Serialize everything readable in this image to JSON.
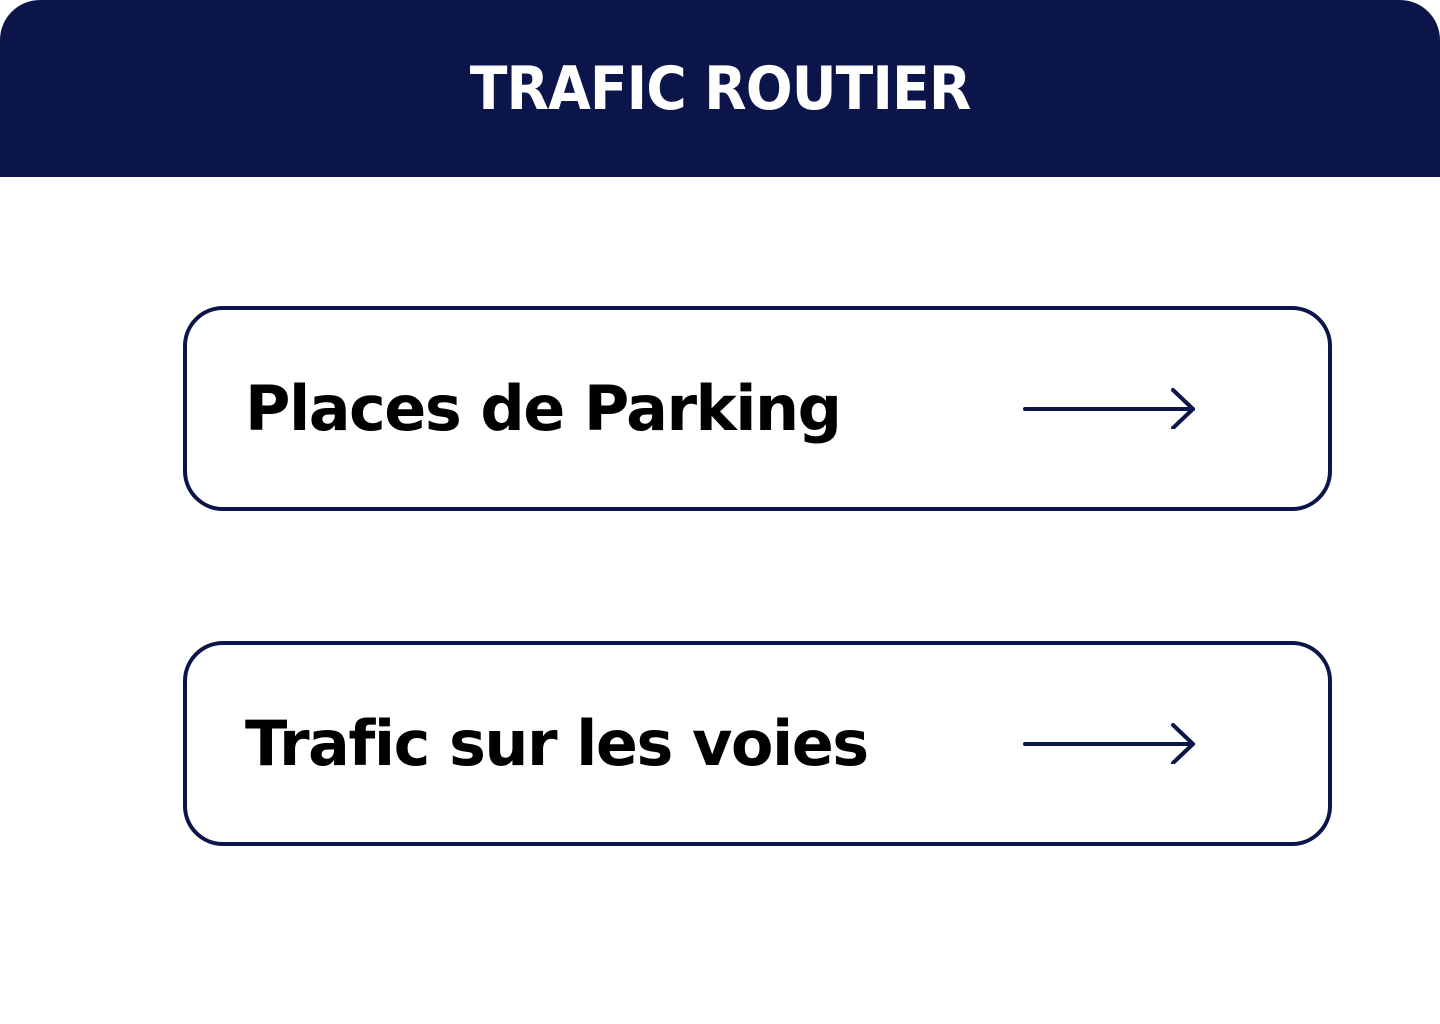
{
  "colors": {
    "header_bg": "#0b1549",
    "header_text": "#ffffff",
    "card_border": "#0b1549",
    "card_text": "#000000",
    "arrow": "#0b1549"
  },
  "header": {
    "title": "TRAFIC ROUTIER"
  },
  "menu": {
    "items": [
      {
        "label": "Places de Parking",
        "icon": "arrow-right-icon"
      },
      {
        "label": "Trafic sur les voies",
        "icon": "arrow-right-icon"
      }
    ]
  }
}
